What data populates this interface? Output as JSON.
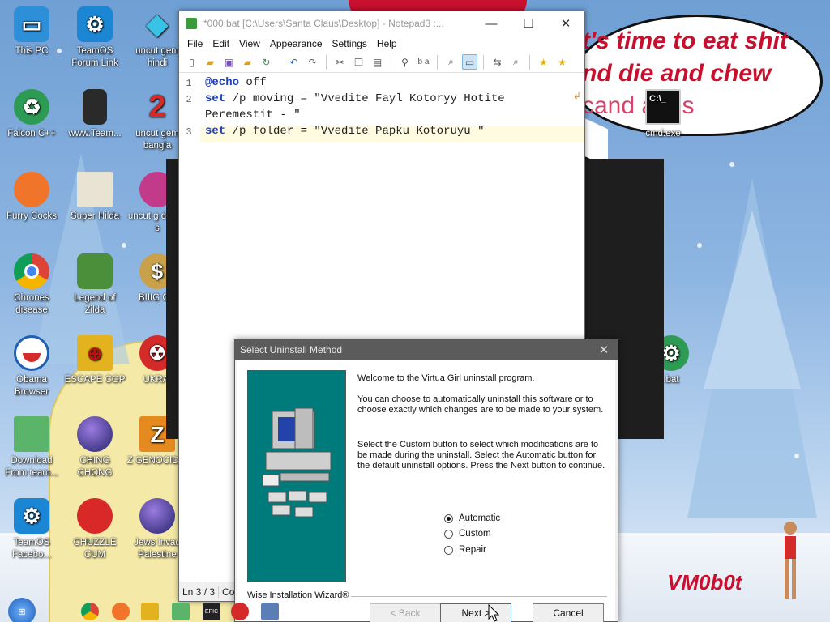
{
  "desktop": {
    "bubble_lines": [
      "t's time to eat shit",
      "nd die and chew",
      "cand     anes"
    ],
    "signature": "VM0b0t",
    "icons": [
      {
        "label": "This PC",
        "icon": "monitor-icon",
        "color": "#2c8fd8"
      },
      {
        "label": "TeamOS Forum Link",
        "icon": "gear-icon",
        "color": "#1b86d3"
      },
      {
        "label": "uncut gem hindi",
        "icon": "diamond-icon",
        "color": "#38c3e6"
      },
      {
        "label": "Falcon C++",
        "icon": "recycle-icon",
        "color": "#2e9b54"
      },
      {
        "label": "www.Team...",
        "icon": "book-icon",
        "color": "#2a2a2a"
      },
      {
        "label": "uncut gem bangla",
        "icon": "number-2-icon",
        "color": "#d42a2a"
      },
      {
        "label": "Furry Cocks",
        "icon": "firefox-icon",
        "color": "#f0752a"
      },
      {
        "label": "Super Hilda",
        "icon": "pixel-cat-icon",
        "color": "#e9e3d3"
      },
      {
        "label": "uncut g delete s",
        "icon": "gem-ball-icon",
        "color": "#c23b8a"
      },
      {
        "label": "Chrones disease",
        "icon": "chrome-icon",
        "color": "#3d8e3d"
      },
      {
        "label": "Legend of Zilda",
        "icon": "zelda-icon",
        "color": "#4b8f3a"
      },
      {
        "label": "BIIIG CU",
        "icon": "money-bag-icon",
        "color": "#c9a14a"
      },
      {
        "label": "Obama Browser",
        "icon": "obama-logo-icon",
        "color": "#1f5fb4"
      },
      {
        "label": "ESCAPE CGP",
        "icon": "mahjong-icon",
        "color": "#e3b21f"
      },
      {
        "label": "UKRAI",
        "icon": "radiation-icon",
        "color": "#d42a2a"
      },
      {
        "label": "Download From team...",
        "icon": "notepad-icon",
        "color": "#5ab56a"
      },
      {
        "label": "CHING CHONG",
        "icon": "orb-icon",
        "color": "#3b3b9b"
      },
      {
        "label": "Z GENOCIDIS",
        "icon": "z-icon",
        "color": "#e58a1f"
      },
      {
        "label": "TeamOS Facebo...",
        "icon": "gear-icon",
        "color": "#1b86d3"
      },
      {
        "label": "CHUZZLE CUM",
        "icon": "chuzzle-icon",
        "color": "#d82828"
      },
      {
        "label": "Jews Invad Palestine",
        "icon": "orb-icon",
        "color": "#3b3b9b"
      },
      {
        "label": "cmd.exe",
        "icon": "cmd-icon",
        "color": "#111111"
      },
      {
        "label": ".bat",
        "icon": "gear-green-icon",
        "color": "#2e9b54"
      }
    ]
  },
  "notepad": {
    "title": "*000.bat [C:\\Users\\Santa Claus\\Desktop] - Notepad3 :...",
    "menu": [
      "File",
      "Edit",
      "View",
      "Appearance",
      "Settings",
      "Help"
    ],
    "lines": [
      {
        "num": "1",
        "kw": "@echo",
        "rest": " off"
      },
      {
        "num": "2",
        "kw": "set",
        "rest": " /p moving = \"Vvedite Fayl Kotoryy Hotite",
        "cont": "Peremestit - \""
      },
      {
        "num": "3",
        "kw": "set",
        "rest": " /p folder = \"Vvedite Papku Kotoruyu \""
      }
    ],
    "status_pos": "Ln 3 / 3",
    "status_col": "Co"
  },
  "dialog": {
    "title": "Select Uninstall Method",
    "welcome": "Welcome to the Virtua Girl uninstall program.",
    "para1": "You can choose to automatically uninstall this software or to choose exactly which changes are to be made to your system.",
    "para2": "Select the Custom button to select which modifications are to be made during the uninstall. Select the Automatic button for the default uninstall options. Press the Next button to continue.",
    "options": [
      {
        "label": "Automatic",
        "selected": true
      },
      {
        "label": "Custom",
        "selected": false
      },
      {
        "label": "Repair",
        "selected": false
      }
    ],
    "wizard_label": "Wise Installation Wizard®",
    "back_label": "< Back",
    "next_label": "Next >",
    "cancel_label": "Cancel"
  }
}
